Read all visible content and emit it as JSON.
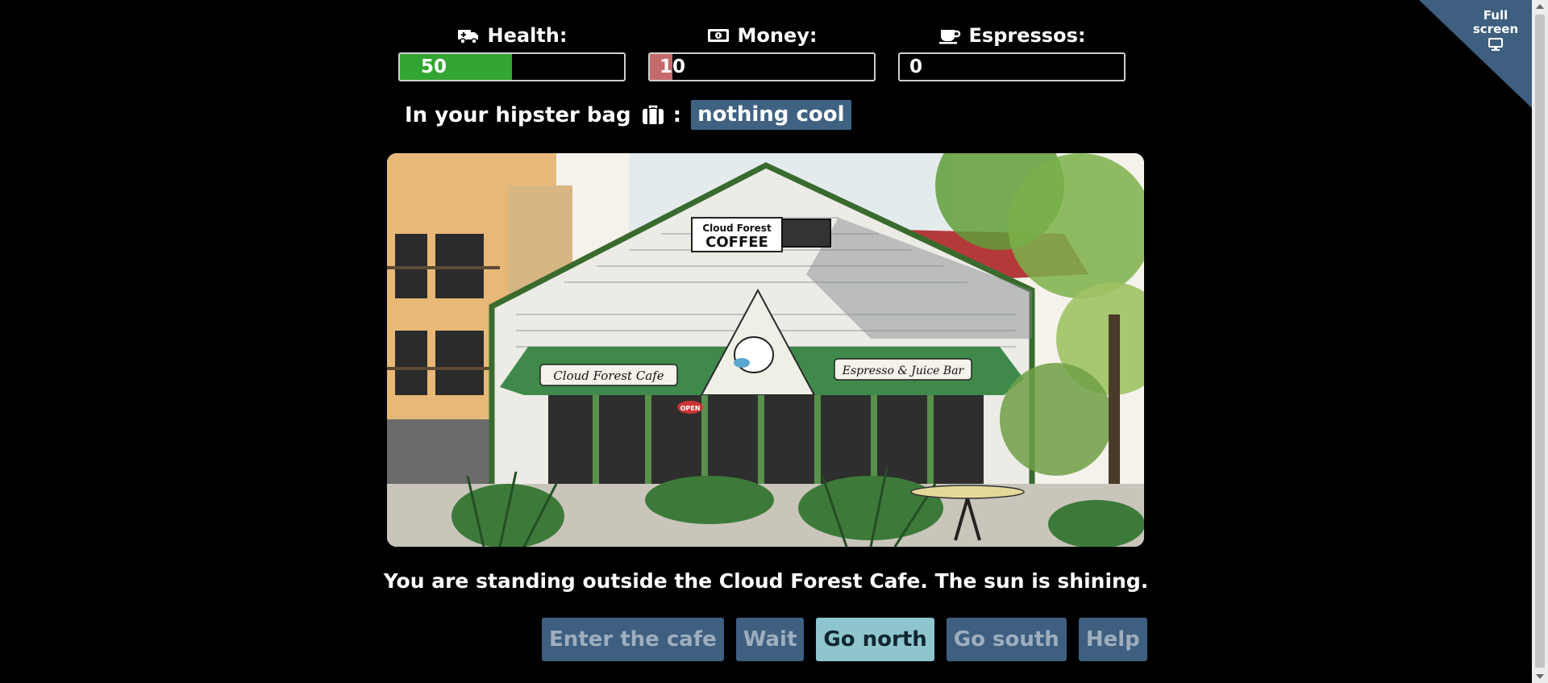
{
  "stats": {
    "health": {
      "label": "Health:",
      "value": "50",
      "fraction": 0.5,
      "fill_color": "#33a532",
      "icon": "ambulance-icon"
    },
    "money": {
      "label": "Money:",
      "value": "10",
      "fraction": 0.1,
      "fill_color": "#c46a6a",
      "icon": "money-bill-icon"
    },
    "espressos": {
      "label": "Espressos:",
      "value": "0",
      "fraction": 0.0,
      "fill_color": "#7a5a3c",
      "icon": "coffee-cup-icon"
    }
  },
  "inventory": {
    "label": "In your hipster bag",
    "icon": "suitcase-icon",
    "separator": ":",
    "item": "nothing cool"
  },
  "scene": {
    "sign_top": "Cloud Forest",
    "sign_bottom": "COFFEE",
    "awning_left": "Cloud Forest Cafe",
    "awning_right": "Espresso & Juice Bar",
    "open_sign": "OPEN"
  },
  "narration": "You are standing outside the Cloud Forest Cafe. The sun is shining.",
  "actions": [
    {
      "label": "Enter the cafe",
      "active": false
    },
    {
      "label": "Wait",
      "active": false
    },
    {
      "label": "Go north",
      "active": true
    },
    {
      "label": "Go south",
      "active": false
    },
    {
      "label": "Help",
      "active": false
    }
  ],
  "fullscreen": {
    "label_line1": "Full",
    "label_line2": "screen",
    "icon": "monitor-icon"
  },
  "colors": {
    "accent": "#3e5f80",
    "active_button": "#8ec5cf",
    "background": "#000000"
  }
}
